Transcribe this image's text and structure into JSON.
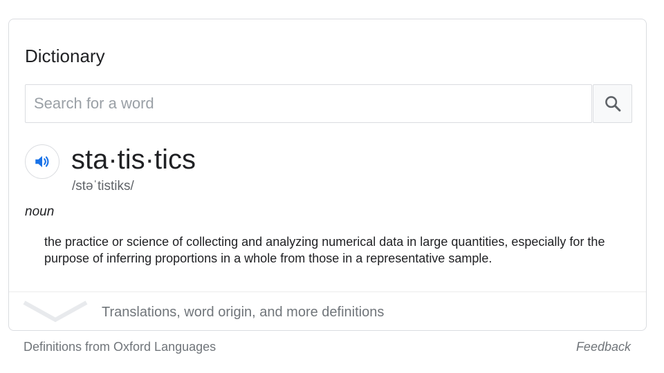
{
  "dictionary": {
    "title": "Dictionary",
    "search": {
      "placeholder": "Search for a word",
      "value": "",
      "button_icon": "search-icon"
    },
    "entry": {
      "audio_icon": "speaker-icon",
      "headword": "sta·tis·tics",
      "pronunciation": "/stəˈtistiks/",
      "part_of_speech": "noun",
      "definition": "the practice or science of collecting and analyzing numerical data in large quantities, especially for the purpose of inferring proportions in a whole from those in a representative sample."
    },
    "expand": {
      "icon": "chevron-down-icon",
      "label": "Translations, word origin, and more definitions"
    }
  },
  "footer": {
    "source": "Definitions from Oxford Languages",
    "feedback": "Feedback"
  },
  "colors": {
    "accent_blue": "#1a73e8",
    "text_primary": "#202124",
    "text_secondary": "#70757a",
    "border": "#dadce0"
  }
}
